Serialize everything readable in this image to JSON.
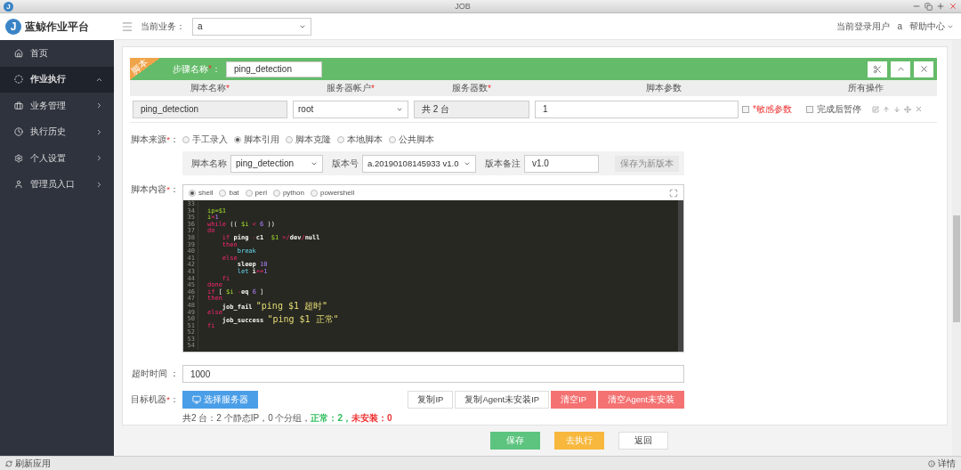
{
  "window": {
    "icon_letter": "J",
    "title": "JOB"
  },
  "app": {
    "logo_letter": "J",
    "name": "蓝鲸作业平台"
  },
  "header": {
    "business_label": "当前业务：",
    "business_value": "a",
    "user_label": "当前登录用户",
    "user_value": "a",
    "help": "帮助中心"
  },
  "sidebar": {
    "items": [
      {
        "label": "首页",
        "selected": false
      },
      {
        "label": "作业执行",
        "selected": true,
        "expanded": true
      },
      {
        "label": "业务管理",
        "selected": false,
        "expanded": false
      },
      {
        "label": "执行历史",
        "selected": false,
        "expanded": false
      },
      {
        "label": "个人设置",
        "selected": false,
        "expanded": false
      },
      {
        "label": "管理员入口",
        "selected": false,
        "expanded": false
      }
    ]
  },
  "step": {
    "tag": "脚本",
    "name_label": {
      "text": "步骤名称",
      "mark": "*",
      "colon": "："
    },
    "name_value": "ping_detection",
    "columns": [
      {
        "label": "脚本名称",
        "mark": "*"
      },
      {
        "label": "服务器帐户",
        "mark": "*"
      },
      {
        "label": "服务器数",
        "mark": "*"
      },
      {
        "label": "脚本参数"
      },
      {
        "label": "所有操作"
      }
    ],
    "row": {
      "script_name": "ping_detection",
      "account": "root",
      "server_count": "共 2 台",
      "params": "1",
      "sensitive": {
        "label": "*敏感参数",
        "checked": false
      },
      "pause": {
        "label": "完成后暂停",
        "checked": false
      }
    }
  },
  "form": {
    "source_label": {
      "text": "脚本来源",
      "mark": "*",
      "colon": "："
    },
    "sources": [
      {
        "label": "手工录入",
        "selected": false
      },
      {
        "label": "脚本引用",
        "selected": true
      },
      {
        "label": "脚本克隆",
        "selected": false
      },
      {
        "label": "本地脚本",
        "selected": false
      },
      {
        "label": "公共脚本",
        "selected": false
      }
    ],
    "ref": {
      "name_label": "脚本名称",
      "name_value": "ping_detection",
      "version_label": "版本号",
      "version_value": "a.20190108145933 v1.0",
      "note_label": "版本备注",
      "note_value": "v1.0",
      "save_button": "保存为新版本",
      "save_disabled": true
    },
    "content_label": {
      "text": "脚本内容",
      "mark": "*",
      "colon": "："
    },
    "languages": [
      {
        "label": "shell",
        "selected": true
      },
      {
        "label": "bat",
        "selected": false
      },
      {
        "label": "perl",
        "selected": false
      },
      {
        "label": "python",
        "selected": false
      },
      {
        "label": "powershell",
        "selected": false
      }
    ],
    "code": [
      {
        "number": "33"
      },
      {
        "number": "34",
        "tokens": [
          {
            "kind": "var",
            "text": "ip=$1"
          }
        ]
      },
      {
        "number": "35",
        "tokens": [
          {
            "kind": "var",
            "text": "i"
          },
          {
            "kind": "op",
            "text": "="
          },
          {
            "kind": "num",
            "text": "1"
          }
        ]
      },
      {
        "number": "36",
        "tokens": [
          {
            "kind": "kw",
            "text": "while"
          },
          {
            "kind": "plain",
            "text": " (( "
          },
          {
            "kind": "var",
            "text": "$i"
          },
          {
            "kind": "op",
            "text": " < "
          },
          {
            "kind": "num",
            "text": "6"
          },
          {
            "kind": "plain",
            "text": " ))"
          }
        ]
      },
      {
        "number": "37",
        "tokens": [
          {
            "kind": "kw",
            "text": "do"
          }
        ]
      },
      {
        "number": "38",
        "tokens": [
          {
            "kind": "kw",
            "text": "    if"
          },
          {
            "kind": "cmd",
            "text": " ping"
          },
          {
            "kind": "op",
            "text": " -"
          },
          {
            "kind": "cmd",
            "text": "c1  "
          },
          {
            "kind": "var",
            "text": "$1"
          },
          {
            "kind": "op",
            "text": " >/"
          },
          {
            "kind": "cmd",
            "text": "dev"
          },
          {
            "kind": "op",
            "text": "/"
          },
          {
            "kind": "cmd",
            "text": "null"
          }
        ]
      },
      {
        "number": "39",
        "tokens": [
          {
            "kind": "kw",
            "text": "    then"
          }
        ]
      },
      {
        "number": "40",
        "tokens": [
          {
            "kind": "builtin",
            "text": "        break"
          }
        ]
      },
      {
        "number": "41",
        "tokens": [
          {
            "kind": "kw",
            "text": "    else"
          }
        ]
      },
      {
        "number": "42",
        "tokens": [
          {
            "kind": "cmd",
            "text": "        sleep "
          },
          {
            "kind": "num",
            "text": "10"
          }
        ]
      },
      {
        "number": "43",
        "tokens": [
          {
            "kind": "builtin",
            "text": "        let "
          },
          {
            "kind": "cmd",
            "text": "i"
          },
          {
            "kind": "op",
            "text": "+="
          },
          {
            "kind": "num",
            "text": "1"
          }
        ]
      },
      {
        "number": "44",
        "tokens": [
          {
            "kind": "kw",
            "text": "    fi"
          }
        ]
      },
      {
        "number": "45",
        "tokens": [
          {
            "kind": "kw",
            "text": "done"
          }
        ]
      },
      {
        "number": "46",
        "tokens": [
          {
            "kind": "kw",
            "text": "if"
          },
          {
            "kind": "plain",
            "text": " [ "
          },
          {
            "kind": "var",
            "text": "$i"
          },
          {
            "kind": "op",
            "text": " -"
          },
          {
            "kind": "cmd",
            "text": "eq "
          },
          {
            "kind": "num",
            "text": "6"
          },
          {
            "kind": "plain",
            "text": " ]"
          }
        ]
      },
      {
        "number": "47",
        "tokens": [
          {
            "kind": "kw",
            "text": "then"
          }
        ]
      },
      {
        "number": "48",
        "tokens": [
          {
            "kind": "cmd",
            "text": "    job_fail "
          },
          {
            "kind": "str",
            "text": "\"ping $1 超时\""
          }
        ]
      },
      {
        "number": "49",
        "tokens": [
          {
            "kind": "kw",
            "text": "else"
          }
        ]
      },
      {
        "number": "50",
        "tokens": [
          {
            "kind": "cmd",
            "text": "    job_success "
          },
          {
            "kind": "str",
            "text": "\"ping $1 正常\""
          }
        ]
      },
      {
        "number": "51",
        "tokens": [
          {
            "kind": "kw",
            "text": "fi"
          }
        ]
      },
      {
        "number": "52"
      },
      {
        "number": "53"
      },
      {
        "number": "54"
      }
    ],
    "timeout_label": {
      "text": "超时时间",
      "colon": " ："
    },
    "timeout_value": "1000",
    "target_label": {
      "text": "目标机器",
      "mark": "*",
      "colon": "："
    },
    "select_button": "选择服务器",
    "target_buttons": [
      {
        "label": "复制IP",
        "kind": "default"
      },
      {
        "label": "复制Agent未安装IP",
        "kind": "default"
      },
      {
        "label": "清空IP",
        "kind": "danger"
      },
      {
        "label": "清空Agent未安装",
        "kind": "danger"
      }
    ],
    "summary": [
      {
        "kind": "plain",
        "text": "共2 台：2 个静态IP，0 个分组，"
      },
      {
        "kind": "ok",
        "text": "正常：2，"
      },
      {
        "kind": "bad",
        "text": "未安装：0"
      }
    ]
  },
  "actions": [
    {
      "label": "保存",
      "kind": "save"
    },
    {
      "label": "去执行",
      "kind": "run"
    },
    {
      "label": "返回",
      "kind": "back"
    }
  ],
  "status_bar": {
    "left": "刷新应用",
    "right": "详情"
  }
}
